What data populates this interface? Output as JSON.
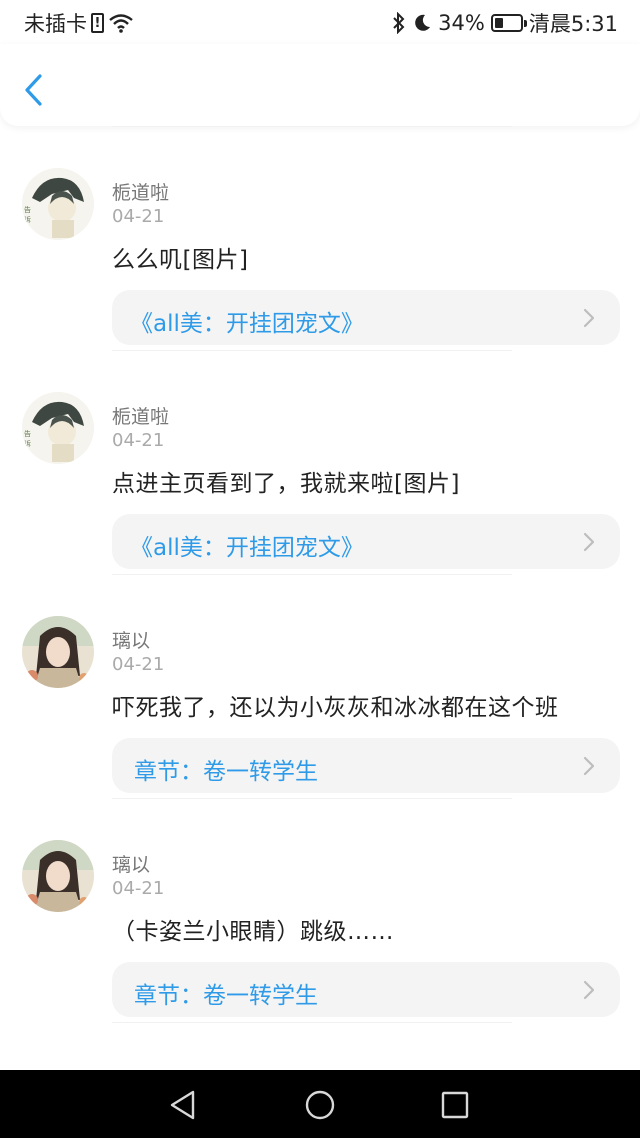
{
  "status_bar": {
    "carrier": "未插卡",
    "battery_percent": "34%",
    "battery_level": 0.34,
    "time": "清晨5:31",
    "icons": [
      "sim-alert-icon",
      "wifi-icon",
      "bluetooth-icon",
      "moon-icon",
      "battery-icon"
    ]
  },
  "header": {
    "back_icon": "chevron-left-icon"
  },
  "comments": [
    {
      "user": "栀道啦",
      "date": "04-21",
      "text": "么么叽[图片]",
      "ref": "《all美：开挂团宠文》"
    },
    {
      "user": "栀道啦",
      "date": "04-21",
      "text": "点进主页看到了，我就来啦[图片]",
      "ref": "《all美：开挂团宠文》"
    },
    {
      "user": "璃以",
      "date": "04-21",
      "text": "吓死我了，还以为小灰灰和冰冰都在这个班",
      "ref": "章节：卷一转学生"
    },
    {
      "user": "璃以",
      "date": "04-21",
      "text": "（卡姿兰小眼睛）跳级……",
      "ref": "章节：卷一转学生"
    }
  ],
  "nav_bar": {
    "icons": [
      "back-triangle-icon",
      "home-circle-icon",
      "recents-square-icon"
    ]
  },
  "colors": {
    "accent": "#2f9be8",
    "card_bg": "#f4f4f4",
    "nav_bg": "#000000"
  }
}
